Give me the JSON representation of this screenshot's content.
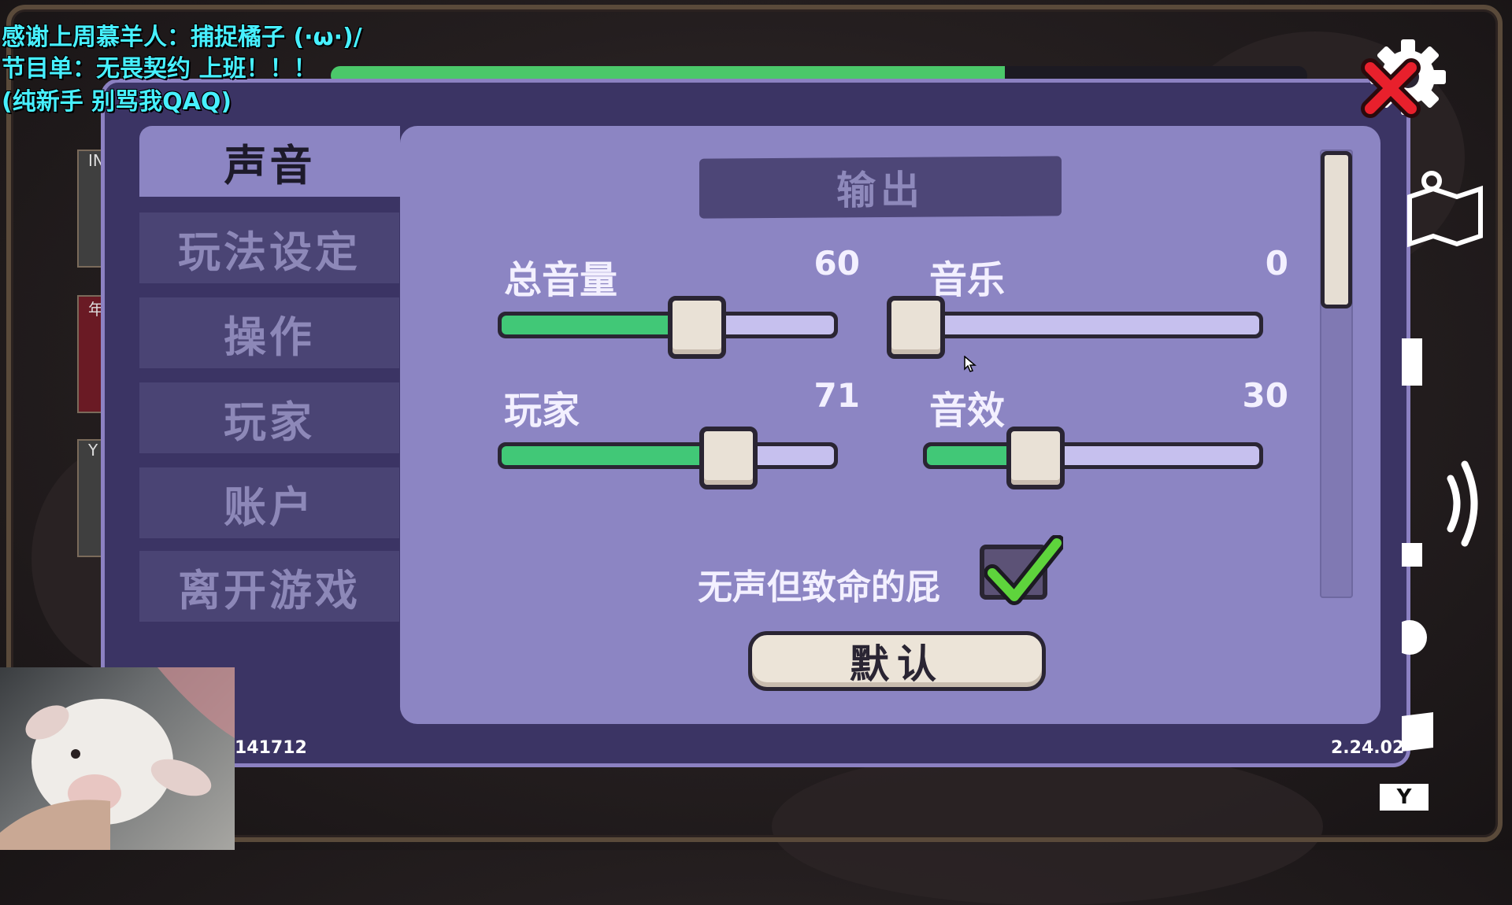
{
  "stream_overlay": {
    "line1": "感谢上周慕羊人：捕捉橘子 (·ω·)/",
    "line2": "节目单：无畏契约 上班！！！",
    "line3": "(纯新手 别骂我QAQ)"
  },
  "top_bar": {
    "progress": 0.69
  },
  "sidebar": {
    "tabs": [
      {
        "label": "声音",
        "active": true
      },
      {
        "label": "玩法设定",
        "active": false
      },
      {
        "label": "操作",
        "active": false
      },
      {
        "label": "玩家",
        "active": false
      },
      {
        "label": "账户",
        "active": false
      },
      {
        "label": "离开游戏",
        "active": false
      }
    ]
  },
  "output_section": {
    "header": "输出",
    "sliders": [
      {
        "label": "总音量",
        "value": 60
      },
      {
        "label": "音乐",
        "value": 0
      },
      {
        "label": "玩家",
        "value": 71
      },
      {
        "label": "音效",
        "value": 30
      }
    ],
    "checkbox": {
      "label": "无声但致命的屁",
      "checked": true
    },
    "default_button": "默认"
  },
  "footer": {
    "left_id": "141712",
    "version": "2.24.02"
  },
  "hud": {
    "y_key": "Y"
  },
  "colors": {
    "panel_bg": "#3b3464",
    "content_bg": "#8c85c3",
    "slider_fill": "#41c877",
    "slider_rest": "#c6c0ee",
    "close_x": "#e8202c",
    "stream_text": "#47f0ff"
  }
}
